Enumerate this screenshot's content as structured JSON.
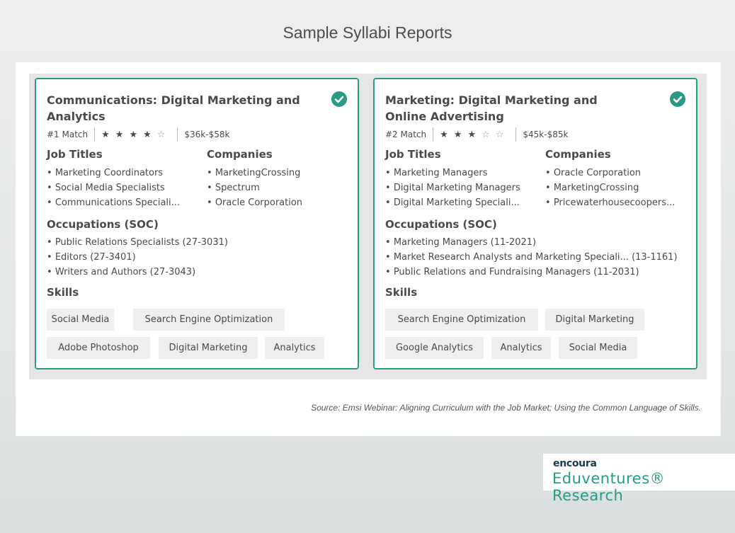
{
  "page": {
    "title": "Sample Syllabi Reports"
  },
  "cards": [
    {
      "title": "Communications: Digital Marketing and Analytics",
      "match": "#1 Match",
      "rating": 4,
      "rating_max": 5,
      "salary": "$36k-$58k",
      "job_titles_heading": "Job Titles",
      "job_titles": [
        "Marketing Coordinators",
        "Social Media Specialists",
        "Communications Speciali..."
      ],
      "companies_heading": "Companies",
      "companies": [
        "MarketingCrossing",
        "Spectrum",
        "Oracle Corporation"
      ],
      "occupations_heading": "Occupations (SOC)",
      "occupations": [
        "Public Relations Specialists (27-3031)",
        "Editors (27-3401)",
        "Writers and Authors (27-3043)"
      ],
      "skills_heading": "Skills",
      "skills": [
        "Social Media",
        "Search Engine Optimization",
        "Adobe Photoshop",
        "Digital Marketing",
        "Analytics"
      ]
    },
    {
      "title": "Marketing: Digital Marketing and Online Advertising",
      "match": "#2 Match",
      "rating": 3,
      "rating_max": 5,
      "salary": "$45k-$85k",
      "job_titles_heading": "Job Titles",
      "job_titles": [
        "Marketing Managers",
        "Digital Marketing Managers",
        "Digital Marketing Speciali..."
      ],
      "companies_heading": "Companies",
      "companies": [
        "Oracle Corporation",
        "MarketingCrossing",
        "Pricewaterhousecoopers..."
      ],
      "occupations_heading": "Occupations (SOC)",
      "occupations": [
        "Marketing Managers (11-2021)",
        "Market Research Analysts and Marketing Speciali... (13-1161)",
        "Public Relations and Fundraising Managers (11-2031)"
      ],
      "skills_heading": "Skills",
      "skills": [
        "Search Engine Optimization",
        "Digital Marketing",
        "Google Analytics",
        "Analytics",
        "Social Media"
      ]
    }
  ],
  "source": "Source: Emsi Webinar: Aligning Curriculum with the Job Market; Using the Common Language of Skills.",
  "brand": {
    "logo": "encoura",
    "name": "Eduventures® Research"
  },
  "colors": {
    "accent": "#2b9a84",
    "text": "#4a4a4a",
    "chip_bg": "#efefef"
  },
  "icons": {
    "check": "check-circle-icon",
    "star": "star-icon"
  }
}
